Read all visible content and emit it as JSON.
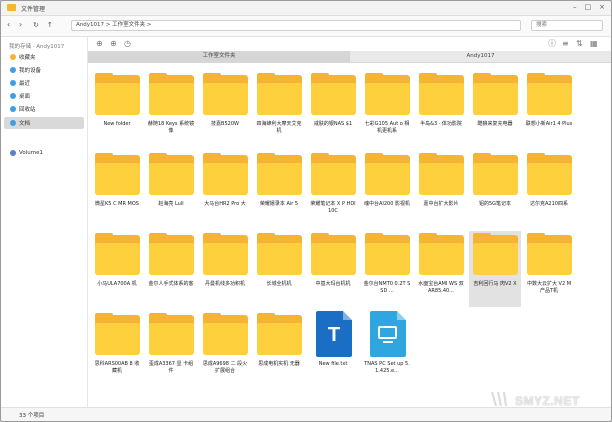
{
  "window": {
    "title": "文件管理"
  },
  "nav": {
    "path": "Andy1017 > 工作室文件夹 >",
    "search_placeholder": "搜索"
  },
  "sidebar": {
    "group_label": "我的存储 · Andy1017",
    "items": [
      {
        "label": "收藏夹",
        "color": "#f5b433"
      },
      {
        "label": "我的设备",
        "color": "#3da0e6"
      },
      {
        "label": "最近",
        "color": "#3da0e6"
      },
      {
        "label": "桌面",
        "color": "#3da0e6"
      },
      {
        "label": "回收站",
        "color": "#3da0e6"
      },
      {
        "label": "文档",
        "color": "#3da0e6"
      }
    ],
    "active_index": 5,
    "volume_label": "Volume1"
  },
  "tabs": [
    {
      "label": "工作室文件夹",
      "active": true
    },
    {
      "label": "Andy1017",
      "active": false
    }
  ],
  "files": [
    {
      "name": "New folder",
      "kind": "folder"
    },
    {
      "name": "赫随18 Keys 系统镜像",
      "kind": "folder"
    },
    {
      "name": "技嘉B520W",
      "kind": "folder"
    },
    {
      "name": "四海蜂利大摩天艾克机",
      "kind": "folder"
    },
    {
      "name": "咸肤的银NAS $1",
      "kind": "folder"
    },
    {
      "name": "七彩G105 Aut o 相机更机系",
      "kind": "folder"
    },
    {
      "name": "半岛&3 · 体功影院",
      "kind": "folder"
    },
    {
      "name": "酷狼来复充电器",
      "kind": "folder"
    },
    {
      "name": "联想小新Air1 4 Plus",
      "kind": "folder"
    },
    {
      "name": "微星K5 C MR MOS",
      "kind": "folder"
    },
    {
      "name": "赵海亮 Lull",
      "kind": "folder"
    },
    {
      "name": "大马台HR2 Pro 大",
      "kind": "folder"
    },
    {
      "name": "荣耀嬉录本 Air 5",
      "kind": "folder"
    },
    {
      "name": "荣耀笔记本 X P HDI10C",
      "kind": "folder"
    },
    {
      "name": "魂中台AI200 影视机",
      "kind": "folder"
    },
    {
      "name": "嘉中台扩大影片",
      "kind": "folder"
    },
    {
      "name": "铝的5G笔记本",
      "kind": "folder"
    },
    {
      "name": "达尔克A210四系",
      "kind": "folder"
    },
    {
      "name": "小马ULA700A 机",
      "kind": "folder"
    },
    {
      "name": "金尔人手式体系的客",
      "kind": "folder"
    },
    {
      "name": "丹曼机线多功积机",
      "kind": "folder"
    },
    {
      "name": "长城全机机",
      "kind": "folder"
    },
    {
      "name": "中基大玛台机机",
      "kind": "folder"
    },
    {
      "name": "金尔台NMT0 0.2T SSD ...",
      "kind": "folder"
    },
    {
      "name": "水面宝台AMI WS 双AR85.40...",
      "kind": "folder"
    },
    {
      "name": "吉利回行马 肉V2 X",
      "kind": "folder",
      "selected": true
    },
    {
      "name": "中数大云扩大 V2 M产品T机",
      "kind": "folder"
    },
    {
      "name": "思科ARS00AB 8 收藏机",
      "kind": "folder"
    },
    {
      "name": "歪成A3367 显 卡组件",
      "kind": "folder"
    },
    {
      "name": "思成A9698 二 段火扩展组合",
      "kind": "folder"
    },
    {
      "name": "思成电机实机 无器",
      "kind": "folder"
    },
    {
      "name": "New file.txt",
      "kind": "txt",
      "color": "#1a6fc4"
    },
    {
      "name": "TNAS PC Set up 5.1.425.e...",
      "kind": "exe",
      "color": "#2fa6e0"
    }
  ],
  "status": {
    "count_text": "33 个项目"
  },
  "watermark": {
    "text": "SMYZ.NET"
  }
}
